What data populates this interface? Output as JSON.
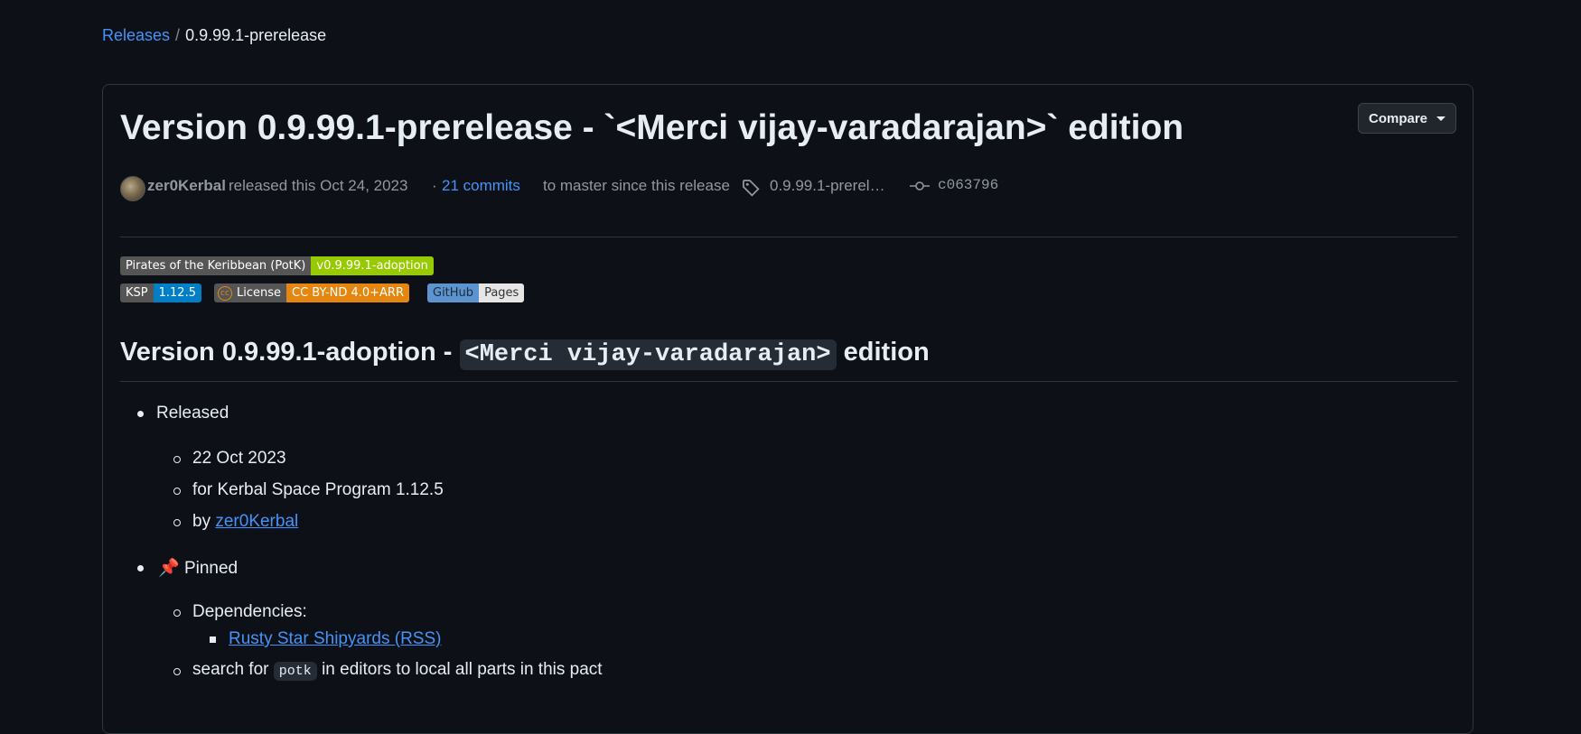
{
  "breadcrumb": {
    "parent": "Releases",
    "separator": "/",
    "current": "0.9.99.1-prerelease"
  },
  "release": {
    "title": "Version 0.9.99.1-prerelease - `<Merci vijay-varadarajan>` edition",
    "compare_label": "Compare",
    "author": "zer0Kerbal",
    "released_text": "released this Oct 24, 2023",
    "dot": "·",
    "commits_link": "21 commits",
    "commits_suffix": "to master since this release",
    "tag": "0.9.99.1-prerel…",
    "commit_hash": "c063796"
  },
  "badges": [
    {
      "left": "Pirates of the Keribbean (PotK)",
      "right": "v0.9.99.1-adoption",
      "left_color": "#555555",
      "right_color": "#97ca00"
    },
    {
      "left": "KSP",
      "right": "1.12.5",
      "left_color": "#555555",
      "right_color": "#007ec6"
    },
    {
      "left": "License",
      "right": "CC BY-ND 4.0+ARR",
      "left_color": "#555555",
      "right_color": "#e4860f",
      "icon": "creative-commons-icon"
    },
    {
      "left": "GitHub",
      "right": "Pages",
      "left_color": "#5b94cf",
      "right_color": "#e6e6e6"
    }
  ],
  "body": {
    "heading_prefix": "Version 0.9.99.1-adoption -",
    "heading_code": "<Merci vijay-varadarajan>",
    "heading_suffix": "edition",
    "released": "Released",
    "date": "22 Oct 2023",
    "for_ksp": "for Kerbal Space Program 1.12.5",
    "by": "by",
    "by_link": "zer0Kerbal",
    "pin_emoji": "📌",
    "pinned": "Pinned",
    "dependencies": "Dependencies:",
    "rss_link": "Rusty Star Shipyards (RSS)",
    "search_prefix": "search for",
    "search_code": "potk",
    "search_suffix": "in editors to local all parts in this pact"
  }
}
